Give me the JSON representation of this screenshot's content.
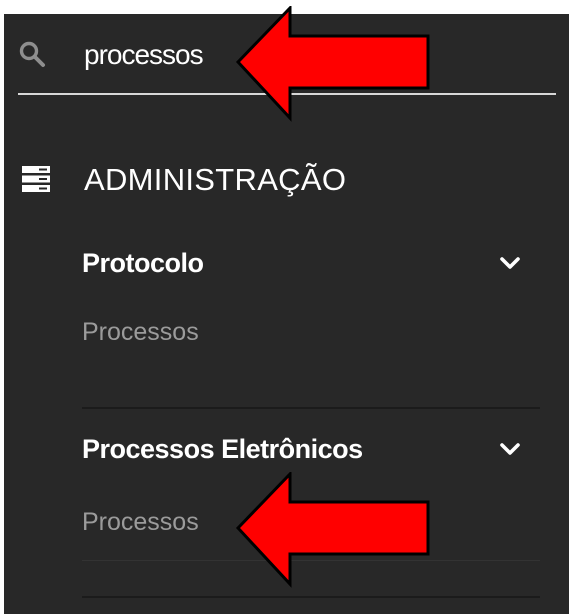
{
  "search": {
    "value": "processos"
  },
  "section": {
    "title": "ADMINISTRAÇÃO",
    "icon": "server-icon"
  },
  "groups": [
    {
      "label": "Protocolo",
      "icon": "chevron-down-icon",
      "items": [
        "Processos"
      ]
    },
    {
      "label": "Processos Eletrônicos",
      "icon": "chevron-down-icon",
      "items": [
        "Processos"
      ]
    }
  ],
  "colors": {
    "panel_background": "#282828",
    "text_primary": "#ffffff",
    "text_secondary": "#9b9b9b",
    "annotation_arrow": "#ff0000"
  },
  "annotations": {
    "icon": "red-arrow-icon"
  }
}
